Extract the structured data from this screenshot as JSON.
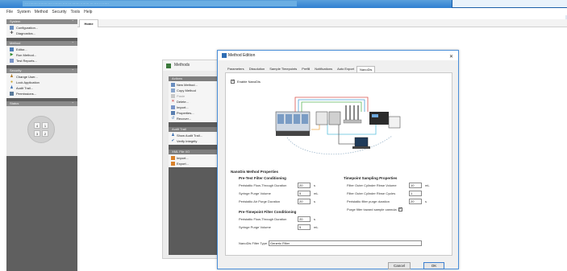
{
  "window": {
    "title_tooltip": "··· ········ ········ ···· ········ ···· ··· ······· ········ ··· ···· ·· ······"
  },
  "menu": [
    "File",
    "System",
    "Method",
    "Security",
    "Tools",
    "Help"
  ],
  "leftnav": {
    "sections": [
      {
        "title": "System",
        "items": [
          {
            "label": "Configuration...",
            "icon": "configuration-icon"
          },
          {
            "label": "Diagnostics...",
            "icon": "diagnostics-icon"
          }
        ]
      },
      {
        "title": "Method",
        "items": [
          {
            "label": "Editor...",
            "icon": "editor-icon"
          },
          {
            "label": "Run Method...",
            "icon": "run-method-icon"
          },
          {
            "label": "Test Reports...",
            "icon": "test-reports-icon"
          }
        ]
      },
      {
        "title": "Security",
        "items": [
          {
            "label": "Change User...",
            "icon": "change-user-icon"
          },
          {
            "label": "Lock Application",
            "icon": "lock-icon"
          },
          {
            "label": "Audit Trail...",
            "icon": "audit-trail-icon"
          },
          {
            "label": "Permissions...",
            "icon": "permissions-icon"
          }
        ]
      },
      {
        "title": "Status",
        "items": []
      }
    ],
    "status_cells": [
      "4",
      "1",
      "3",
      "2"
    ]
  },
  "tabs": {
    "home": "Home"
  },
  "methods_window": {
    "title": "Methods",
    "sections": [
      {
        "title": "Actions",
        "items": [
          "New Method...",
          "Copy Method",
          "Paste",
          "Delete...",
          "Import...",
          "Properties...",
          "Recover..."
        ]
      },
      {
        "title": "Audit Trail",
        "items": [
          "Show Audit Trail...",
          "Verify Integrity"
        ]
      },
      {
        "title": "XML File I/O",
        "items": [
          "Import...",
          "Export..."
        ]
      }
    ]
  },
  "dialog": {
    "title": "Method Edition",
    "close": "✕",
    "tabs": [
      "Parameters",
      "Dissolution",
      "Sample Timepoints",
      "Prefill",
      "Notifications",
      "Auto Export",
      "NanoDis"
    ],
    "active_tab": "NanoDis",
    "enable_label": "Enable NanoDis",
    "enable_checked": true,
    "properties_title": "NanoDis Method Properties",
    "pretest": {
      "title": "Pre-Test Filter Conditioning",
      "rows": [
        {
          "label": "Peristaltic Flow-Through Duration",
          "value": "20",
          "unit": "s"
        },
        {
          "label": "Syringe Purge Volume",
          "value": "5",
          "unit": "mL"
        },
        {
          "label": "Peristaltic Air Purge Duration",
          "value": "20",
          "unit": "s"
        }
      ]
    },
    "pretimepoint": {
      "title": "Pre-Timepoint Filter Conditioning",
      "rows": [
        {
          "label": "Peristaltic Flow-Through Duration",
          "value": "20",
          "unit": "s"
        },
        {
          "label": "Syringe Purge Volume",
          "value": "5",
          "unit": "mL"
        }
      ]
    },
    "timepoint": {
      "title": "Timepoint Sampling Properties",
      "rows": [
        {
          "label": "Filter Outer Cylinder Rinse Volume",
          "value": "10",
          "unit": "mL"
        },
        {
          "label": "Filter Outer Cylinder Rinse Cycles",
          "value": "1",
          "unit": ""
        },
        {
          "label": "Peristaltic filter purge duration",
          "value": "20",
          "unit": "s"
        }
      ],
      "purge_label": "Purge filter toward sample cannula",
      "purge_checked": true
    },
    "filter_type_label": "NanoDis Filter Type",
    "filter_type_value": "Generic Filter",
    "cancel": "Cancel",
    "ok": "OK"
  }
}
